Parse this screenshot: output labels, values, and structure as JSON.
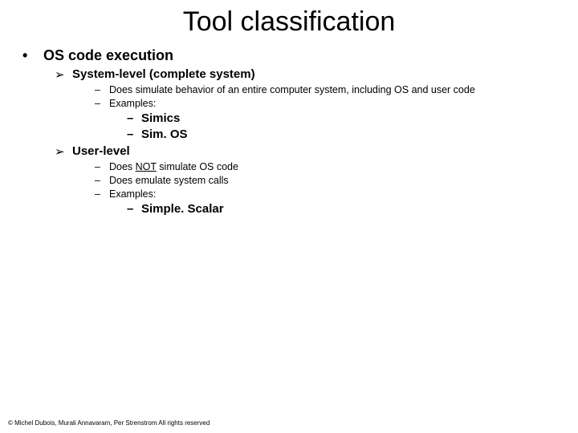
{
  "title": "Tool classification",
  "lvl1": {
    "bullet": "•",
    "text": "OS code execution"
  },
  "lvl2a": {
    "bullet": "➢",
    "text": "System-level (complete system)"
  },
  "lvl3a": {
    "bullet": "–",
    "text": "Does simulate behavior of an entire computer system, including OS and user code"
  },
  "lvl3b": {
    "bullet": "–",
    "text": "Examples:"
  },
  "lvl4a": {
    "bullet": "–",
    "text": "Simics"
  },
  "lvl4b": {
    "bullet": "–",
    "text": "Sim. OS"
  },
  "lvl2b": {
    "bullet": "➢",
    "text": "User-level"
  },
  "lvl3c_pre": "Does ",
  "lvl3c_u": "NOT",
  "lvl3c_post": " simulate OS code",
  "lvl3c_bullet": "–",
  "lvl3d": {
    "bullet": "–",
    "text": "Does emulate system calls"
  },
  "lvl3e": {
    "bullet": "–",
    "text": "Examples:"
  },
  "lvl4c": {
    "bullet": "–",
    "text": "Simple. Scalar"
  },
  "footer": "© Michel Dubois, Murali Annavaram, Per Strenstrom All rights reserved"
}
